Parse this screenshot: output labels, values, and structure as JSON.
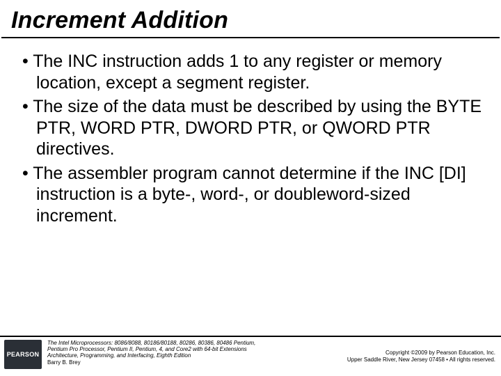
{
  "title": "Increment Addition",
  "bullets": [
    "The INC instruction adds 1 to any register or memory location, except a segment register.",
    "The size of the data must be described by using the BYTE PTR, WORD PTR, DWORD PTR, or QWORD PTR directives.",
    "The assembler program cannot determine if the INC [DI] instruction is a byte-, word-, or doubleword-sized increment."
  ],
  "footer": {
    "logo_text": "PEARSON",
    "left_line1": "The Intel Microprocessors: 8086/8088, 80186/80188, 80286, 80386, 80486 Pentium,",
    "left_line2": "Pentium Pro Processor, Pentium II, Pentium, 4, and Core2 with 64-bit Extensions",
    "left_line3": "Architecture, Programming, and Interfacing, Eighth Edition",
    "left_line4": "Barry B. Brey",
    "right_line1": "Copyright ©2009 by Pearson Education, Inc.",
    "right_line2": "Upper Saddle River, New Jersey 07458 • All rights reserved."
  }
}
